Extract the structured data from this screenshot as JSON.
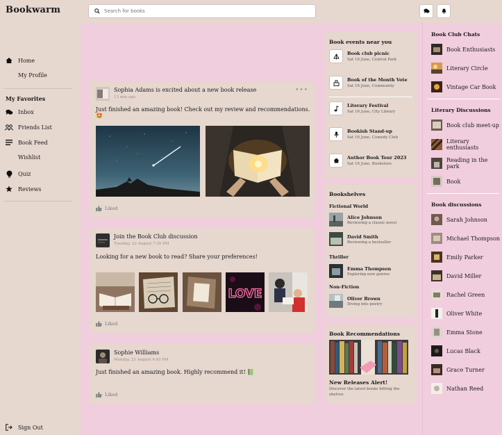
{
  "app": {
    "title": "Bookwarm"
  },
  "search": {
    "placeholder": "Search for books"
  },
  "nav": {
    "home": "Home",
    "profile": "My Profile",
    "favorites_title": "My Favorites",
    "inbox": "Inbox",
    "friends": "Friends List",
    "feed": "Book Feed",
    "wishlist": "Wishlist",
    "quiz": "Quiz",
    "reviews": "Reviews",
    "signout": "Sign Out"
  },
  "posts": [
    {
      "name": "Sophia Adams is excited about a new book release",
      "time": "13 min ago",
      "text": "Just finished an amazing book! Check out my review and recommendations. 🤩",
      "liked": "Liked"
    },
    {
      "name": "Join the Book Club discussion",
      "time": "Tuesday, 22 August 7:30 PM",
      "text": "Looking for a new book to read? Share your preferences!",
      "liked": "Liked"
    },
    {
      "name": "Sophie Williams",
      "time": "Monday, 21 August 4:45 PM",
      "text": "Just finished an amazing book. Highly recommend it! 📗",
      "liked": "Liked"
    }
  ],
  "events": {
    "title": "Book events near you",
    "items": [
      {
        "name": "Book club picnic",
        "sub": "Sat 16 June, Central Park",
        "icon": "picnic-icon"
      },
      {
        "name": "Book of the Month Vote",
        "sub": "Sat 16 June, Community",
        "icon": "vote-icon"
      },
      {
        "name": "Literary Festival",
        "sub": "Sat 16 June, City Library",
        "icon": "music-icon"
      },
      {
        "name": "Bookish Stand-up",
        "sub": "Sat 16 June, Comedy Club",
        "icon": "mic-icon"
      },
      {
        "name": "Author Book Tour 2023",
        "sub": "Sat 16 June, Bookstore",
        "icon": "house-icon"
      }
    ]
  },
  "bookshelves": {
    "title": "Bookshelves",
    "categories": [
      {
        "name": "Fictional World",
        "items": [
          {
            "name": "Alice Johnson",
            "sub": "Reviewing a classic novel"
          },
          {
            "name": "David Smith",
            "sub": "Reviewing a bestseller"
          }
        ]
      },
      {
        "name": "Thriller",
        "items": [
          {
            "name": "Emma Thompson",
            "sub": "Exploring new genres"
          }
        ]
      },
      {
        "name": "Non-Fiction",
        "items": [
          {
            "name": "Oliver Brown",
            "sub": "Diving into poetry"
          }
        ]
      }
    ]
  },
  "recommendations": {
    "title": "Book Recommendations",
    "headline": "New Releases Alert!",
    "text": "Discover the latest books hitting the shelves"
  },
  "club_chats": {
    "title": "Book Club Chats",
    "items": [
      "Book Enthusiasts",
      "Literary Circle",
      "Vintage Car Book"
    ]
  },
  "literary_discussions": {
    "title": "Literary Discussions",
    "items": [
      "Book club meet-up",
      "Literary enthusiasts",
      "Reading in the park",
      "Book"
    ]
  },
  "book_discussions": {
    "title": "Book discussions",
    "items": [
      "Sarah Johnson",
      "Michael Thompson",
      "Emily Parker",
      "David Miller",
      "Rachel Green",
      "Oliver White",
      "Emma Stone",
      "Lucas Black",
      "Grace Turner",
      "Nathan Reed"
    ]
  },
  "colors": {
    "background": "#e6d7cf",
    "accent": "#f1cedd"
  }
}
